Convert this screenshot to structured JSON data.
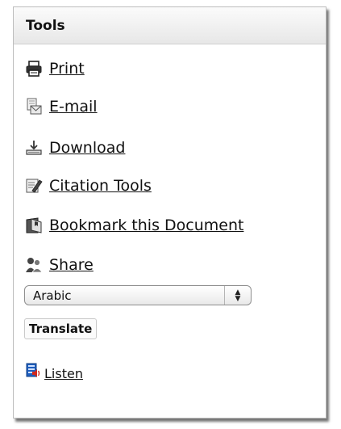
{
  "panel": {
    "title": "Tools"
  },
  "tools": [
    {
      "label": "Print",
      "icon": "printer-icon"
    },
    {
      "label": "E-mail",
      "icon": "email-icon"
    },
    {
      "label": "Download",
      "icon": "download-icon"
    },
    {
      "label": "Citation Tools",
      "icon": "citation-icon"
    },
    {
      "label": "Bookmark this Document",
      "icon": "bookmark-icon"
    },
    {
      "label": "Share",
      "icon": "share-icon"
    }
  ],
  "translate": {
    "selected_language": "Arabic",
    "button_label": "Translate"
  },
  "listen": {
    "label": "Listen",
    "icon": "speaker-icon",
    "accent_color": "#1f5fbf",
    "speaker_color": "#d2281e"
  }
}
